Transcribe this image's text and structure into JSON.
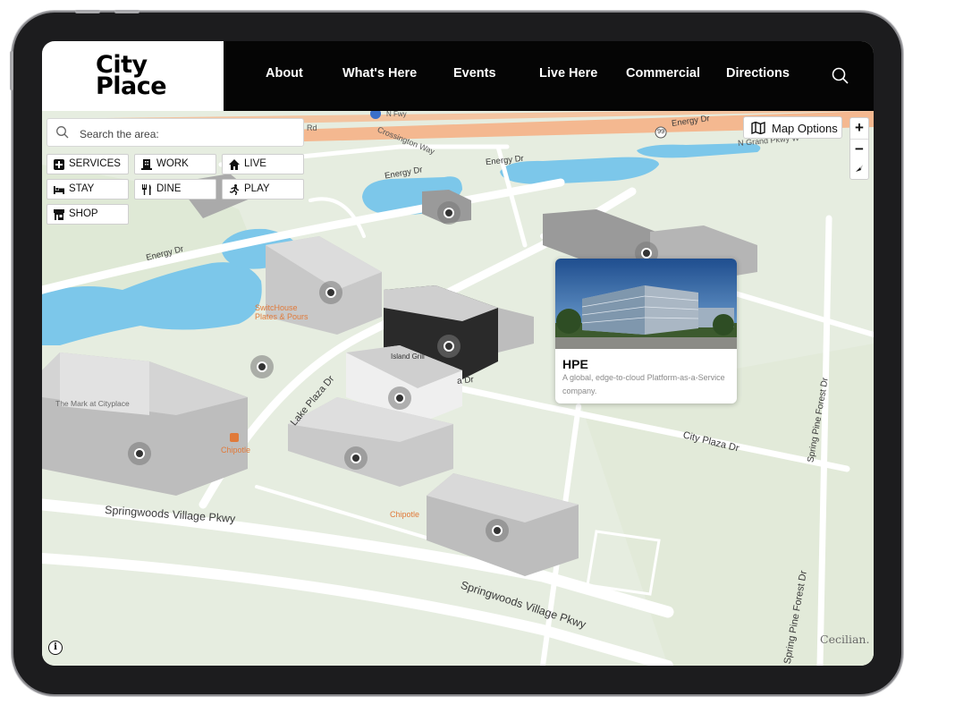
{
  "brand": {
    "line1": "City",
    "line2": "Place"
  },
  "nav": {
    "items": [
      {
        "label": "About"
      },
      {
        "label": "What's Here"
      },
      {
        "label": "Events"
      },
      {
        "label": "Live Here"
      },
      {
        "label": "Commercial"
      },
      {
        "label": "Directions"
      }
    ]
  },
  "map": {
    "search_placeholder": "Search the area:",
    "categories": [
      {
        "label": "SERVICES",
        "icon": "plus-square-icon"
      },
      {
        "label": "WORK",
        "icon": "building-icon"
      },
      {
        "label": "LIVE",
        "icon": "home-icon"
      },
      {
        "label": "STAY",
        "icon": "bed-icon"
      },
      {
        "label": "DINE",
        "icon": "utensils-icon"
      },
      {
        "label": "PLAY",
        "icon": "running-person-icon"
      },
      {
        "label": "SHOP",
        "icon": "store-icon"
      }
    ],
    "map_options_label": "Map Options",
    "zoom_in": "+",
    "zoom_out": "−",
    "popup": {
      "title": "HPE",
      "description": "A global, edge-to-cloud Platform-as-a-Service company."
    },
    "street_labels": {
      "energy_dr_1": "Energy Dr",
      "energy_dr_2": "Energy Dr",
      "energy_dr_3": "Energy Dr",
      "energy_dr_4": "Energy Dr",
      "crossington_way": "Crossington Way",
      "n_grand_pkwy": "N Grand Pkwy W",
      "lake_plaza_dr": "Lake Plaza Dr",
      "city_plaza_dr": "City Plaza Dr",
      "spring_pine_forest_dr_1": "Spring Pine Forest Dr",
      "spring_pine_forest_dr_2": "Spring Pine Forest Dr",
      "springwoods_village_pkwy_1": "Springwoods Village Pkwy",
      "springwoods_village_pkwy_2": "Springwoods Village Pkwy",
      "n_fwy": "N Fwy",
      "rd": "Rd",
      "la_dr": "a Dr",
      "highway_shield": "99"
    },
    "place_labels": {
      "mark_at_cityplace": "The Mark at Cityplace",
      "switchhouse": "SwitcHouse",
      "plates_pours": "Plates & Pours",
      "island_grill": "Island Grill",
      "chipotle_1": "Chipotle",
      "chipotle_2": "Chipotle"
    },
    "watermark": "Cecilian.",
    "info_icon": "i"
  },
  "colors": {
    "header_bg": "#050505",
    "map_bg": "#e9efe4",
    "water": "#7cc7ea",
    "highway": "#f4b890"
  }
}
